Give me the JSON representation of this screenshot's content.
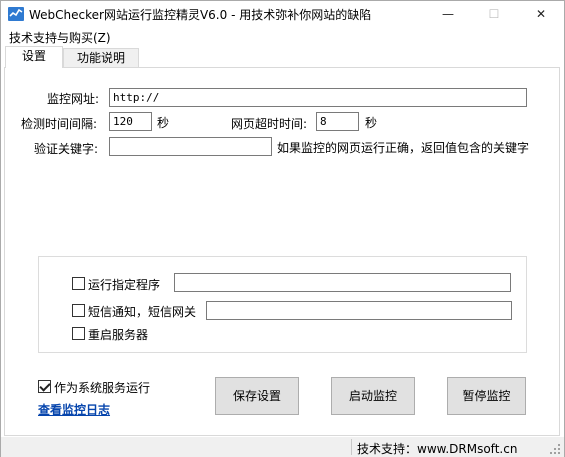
{
  "window": {
    "title": "WebChecker网站运行监控精灵V6.0 - 用技术弥补你网站的缺陷",
    "minimize_glyph": "—",
    "maximize_glyph": "☐",
    "close_glyph": "✕"
  },
  "menu": {
    "support_purchase": "技术支持与购买(Z)"
  },
  "tabs": [
    {
      "label": "设置",
      "active": true
    },
    {
      "label": "功能说明",
      "active": false
    }
  ],
  "settings": {
    "url_label": "监控网址:",
    "url_value": "http://",
    "interval_label": "检测时间间隔:",
    "interval_value": "120",
    "interval_unit": "秒",
    "timeout_label": "网页超时时间:",
    "timeout_value": "8",
    "timeout_unit": "秒",
    "keyword_label": "验证关键字:",
    "keyword_value": "",
    "keyword_hint": "如果监控的网页运行正确，返回值包含的关键字"
  },
  "actions": {
    "run_program_label": "运行指定程序",
    "run_program_checked": false,
    "run_program_value": "",
    "sms_label": "短信通知，短信网关",
    "sms_checked": false,
    "sms_value": "",
    "restart_label": "重启服务器",
    "restart_checked": false
  },
  "service": {
    "run_as_service_label": "作为系统服务运行",
    "run_as_service_checked": true,
    "view_log_link": "查看监控日志"
  },
  "buttons": {
    "save": "保存设置",
    "start": "启动监控",
    "pause": "暂停监控"
  },
  "statusbar": {
    "text": "技术支持：www.DRMsoft.cn"
  },
  "colors": {
    "link": "#0645ad",
    "button_face": "#e1e1e1"
  }
}
